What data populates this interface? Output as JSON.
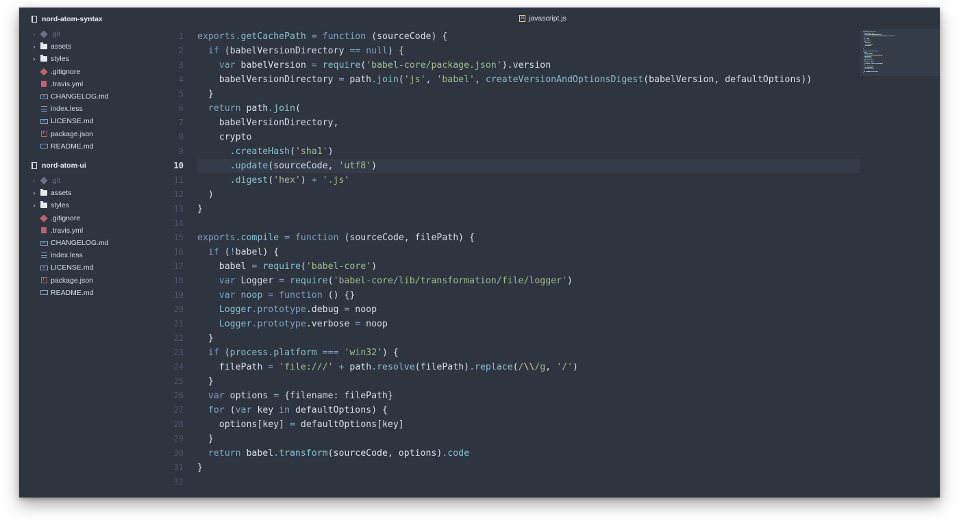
{
  "projects": [
    {
      "name": "nord-atom-syntax",
      "items": [
        {
          "name": ".git",
          "icon": "git-icon",
          "expandable": true,
          "dim": true
        },
        {
          "name": "assets",
          "icon": "folder-icon",
          "expandable": true,
          "dim": false
        },
        {
          "name": "styles",
          "icon": "folder-icon",
          "expandable": true,
          "dim": false
        },
        {
          "name": ".gitignore",
          "icon": "git-icon",
          "expandable": false,
          "dim": false
        },
        {
          "name": ".travis.yml",
          "icon": "travis-icon",
          "expandable": false,
          "dim": false
        },
        {
          "name": "CHANGELOG.md",
          "icon": "markdown-icon",
          "expandable": false,
          "dim": false
        },
        {
          "name": "index.less",
          "icon": "less-icon",
          "expandable": false,
          "dim": false
        },
        {
          "name": "LICENSE.md",
          "icon": "markdown-icon",
          "expandable": false,
          "dim": false
        },
        {
          "name": "package.json",
          "icon": "npm-package-icon",
          "expandable": false,
          "dim": false
        },
        {
          "name": "README.md",
          "icon": "readme-icon",
          "expandable": false,
          "dim": false
        }
      ]
    },
    {
      "name": "nord-atom-ui",
      "items": [
        {
          "name": ".git",
          "icon": "git-icon",
          "expandable": true,
          "dim": true
        },
        {
          "name": "assets",
          "icon": "folder-icon",
          "expandable": true,
          "dim": false
        },
        {
          "name": "styles",
          "icon": "folder-icon",
          "expandable": true,
          "dim": false
        },
        {
          "name": ".gitignore",
          "icon": "git-icon",
          "expandable": false,
          "dim": false
        },
        {
          "name": ".travis.yml",
          "icon": "travis-icon",
          "expandable": false,
          "dim": false
        },
        {
          "name": "CHANGELOG.md",
          "icon": "markdown-icon",
          "expandable": false,
          "dim": false
        },
        {
          "name": "index.less",
          "icon": "less-icon",
          "expandable": false,
          "dim": false
        },
        {
          "name": "LICENSE.md",
          "icon": "markdown-icon",
          "expandable": false,
          "dim": false
        },
        {
          "name": "package.json",
          "icon": "npm-package-icon",
          "expandable": false,
          "dim": false
        },
        {
          "name": "README.md",
          "icon": "readme-icon",
          "expandable": false,
          "dim": false
        }
      ]
    }
  ],
  "tab": {
    "title": "javascript.js",
    "icon": "js-icon"
  },
  "editor": {
    "active_line": 10,
    "colors": {
      "background": "#2e3440",
      "keyword": "#81a1c1",
      "function": "#88c0d0",
      "string": "#a3be8c",
      "text": "#d8dee9",
      "line_number": "#4c566a",
      "escape": "#ebcb8b"
    },
    "lines": [
      [
        [
          "k",
          "exports"
        ],
        [
          "fn",
          ".getCachePath"
        ],
        [
          "t",
          " "
        ],
        [
          "op",
          "="
        ],
        [
          "t",
          " "
        ],
        [
          "k",
          "function"
        ],
        [
          "t",
          " (sourceCode) {"
        ]
      ],
      [
        [
          "t",
          "  "
        ],
        [
          "k",
          "if"
        ],
        [
          "t",
          " (babelVersionDirectory "
        ],
        [
          "op",
          "=="
        ],
        [
          "t",
          " "
        ],
        [
          "k",
          "null"
        ],
        [
          "t",
          ") {"
        ]
      ],
      [
        [
          "t",
          "    "
        ],
        [
          "k",
          "var"
        ],
        [
          "t",
          " babelVersion "
        ],
        [
          "op",
          "="
        ],
        [
          "t",
          " "
        ],
        [
          "fn",
          "require"
        ],
        [
          "t",
          "("
        ],
        [
          "s",
          "'babel-core/package.json'"
        ],
        [
          "t",
          ").version"
        ]
      ],
      [
        [
          "t",
          "    babelVersionDirectory "
        ],
        [
          "op",
          "="
        ],
        [
          "t",
          " path"
        ],
        [
          "fn",
          ".join"
        ],
        [
          "t",
          "("
        ],
        [
          "s",
          "'js'"
        ],
        [
          "t",
          ", "
        ],
        [
          "s",
          "'babel'"
        ],
        [
          "t",
          ", "
        ],
        [
          "fn",
          "createVersionAndOptionsDigest"
        ],
        [
          "t",
          "(babelVersion, defaultOptions))"
        ]
      ],
      [
        [
          "t",
          "  }"
        ]
      ],
      [
        [
          "t",
          "  "
        ],
        [
          "k",
          "return"
        ],
        [
          "t",
          " path"
        ],
        [
          "fn",
          ".join"
        ],
        [
          "t",
          "("
        ]
      ],
      [
        [
          "t",
          "    babelVersionDirectory,"
        ]
      ],
      [
        [
          "t",
          "    crypto"
        ]
      ],
      [
        [
          "t",
          "      "
        ],
        [
          "fn",
          ".createHash"
        ],
        [
          "t",
          "("
        ],
        [
          "s",
          "'sha1'"
        ],
        [
          "t",
          ")"
        ]
      ],
      [
        [
          "t",
          "      "
        ],
        [
          "fn",
          ".update"
        ],
        [
          "t",
          "(sourceCode, "
        ],
        [
          "s",
          "'utf8'"
        ],
        [
          "t",
          ")"
        ]
      ],
      [
        [
          "t",
          "      "
        ],
        [
          "fn",
          ".digest"
        ],
        [
          "t",
          "("
        ],
        [
          "s",
          "'hex'"
        ],
        [
          "t",
          ") "
        ],
        [
          "op",
          "+"
        ],
        [
          "t",
          " "
        ],
        [
          "s",
          "'.js'"
        ]
      ],
      [
        [
          "t",
          "  )"
        ]
      ],
      [
        [
          "t",
          "}"
        ]
      ],
      [],
      [
        [
          "k",
          "exports"
        ],
        [
          "fn",
          ".compile"
        ],
        [
          "t",
          " "
        ],
        [
          "op",
          "="
        ],
        [
          "t",
          " "
        ],
        [
          "k",
          "function"
        ],
        [
          "t",
          " (sourceCode, filePath) {"
        ]
      ],
      [
        [
          "t",
          "  "
        ],
        [
          "k",
          "if"
        ],
        [
          "t",
          " ("
        ],
        [
          "op",
          "!"
        ],
        [
          "t",
          "babel) {"
        ]
      ],
      [
        [
          "t",
          "    babel "
        ],
        [
          "op",
          "="
        ],
        [
          "t",
          " "
        ],
        [
          "fn",
          "require"
        ],
        [
          "t",
          "("
        ],
        [
          "s",
          "'babel-core'"
        ],
        [
          "t",
          ")"
        ]
      ],
      [
        [
          "t",
          "    "
        ],
        [
          "k",
          "var"
        ],
        [
          "t",
          " Logger "
        ],
        [
          "op",
          "="
        ],
        [
          "t",
          " "
        ],
        [
          "fn",
          "require"
        ],
        [
          "t",
          "("
        ],
        [
          "s",
          "'babel-core/lib/transformation/file/logger'"
        ],
        [
          "t",
          ")"
        ]
      ],
      [
        [
          "t",
          "    "
        ],
        [
          "k",
          "var"
        ],
        [
          "t",
          " "
        ],
        [
          "fn",
          "noop"
        ],
        [
          "t",
          " "
        ],
        [
          "op",
          "="
        ],
        [
          "t",
          " "
        ],
        [
          "k",
          "function"
        ],
        [
          "t",
          " () {}"
        ]
      ],
      [
        [
          "t",
          "    "
        ],
        [
          "fn",
          "Logger"
        ],
        [
          "k",
          ".prototype"
        ],
        [
          "t",
          ".debug "
        ],
        [
          "op",
          "="
        ],
        [
          "t",
          " noop"
        ]
      ],
      [
        [
          "t",
          "    "
        ],
        [
          "fn",
          "Logger"
        ],
        [
          "k",
          ".prototype"
        ],
        [
          "t",
          ".verbose "
        ],
        [
          "op",
          "="
        ],
        [
          "t",
          " noop"
        ]
      ],
      [
        [
          "t",
          "  }"
        ]
      ],
      [
        [
          "t",
          "  "
        ],
        [
          "k",
          "if"
        ],
        [
          "t",
          " ("
        ],
        [
          "fn",
          "process.platform"
        ],
        [
          "t",
          " "
        ],
        [
          "op",
          "==="
        ],
        [
          "t",
          " "
        ],
        [
          "s",
          "'win32'"
        ],
        [
          "t",
          ") {"
        ]
      ],
      [
        [
          "t",
          "    filePath "
        ],
        [
          "op",
          "="
        ],
        [
          "t",
          " "
        ],
        [
          "s",
          "'file:///'"
        ],
        [
          "t",
          " "
        ],
        [
          "op",
          "+"
        ],
        [
          "t",
          " path"
        ],
        [
          "fn",
          ".resolve"
        ],
        [
          "t",
          "(filePath)"
        ],
        [
          "fn",
          ".replace"
        ],
        [
          "t",
          "("
        ],
        [
          "s",
          "/"
        ],
        [
          "sp",
          "\\\\"
        ],
        [
          "s",
          "/g"
        ],
        [
          "t",
          ", "
        ],
        [
          "s",
          "'/'"
        ],
        [
          "t",
          ")"
        ]
      ],
      [
        [
          "t",
          "  }"
        ]
      ],
      [
        [
          "t",
          "  "
        ],
        [
          "k",
          "var"
        ],
        [
          "t",
          " options "
        ],
        [
          "op",
          "="
        ],
        [
          "t",
          " {filename: filePath}"
        ]
      ],
      [
        [
          "t",
          "  "
        ],
        [
          "k",
          "for"
        ],
        [
          "t",
          " ("
        ],
        [
          "k",
          "var"
        ],
        [
          "t",
          " key "
        ],
        [
          "k",
          "in"
        ],
        [
          "t",
          " defaultOptions) {"
        ]
      ],
      [
        [
          "t",
          "    options[key] "
        ],
        [
          "op",
          "="
        ],
        [
          "t",
          " defaultOptions[key]"
        ]
      ],
      [
        [
          "t",
          "  }"
        ]
      ],
      [
        [
          "t",
          "  "
        ],
        [
          "k",
          "return"
        ],
        [
          "t",
          " babel"
        ],
        [
          "fn",
          ".transform"
        ],
        [
          "t",
          "(sourceCode, options)"
        ],
        [
          "fn",
          ".code"
        ]
      ],
      [
        [
          "t",
          "}"
        ]
      ],
      []
    ]
  }
}
